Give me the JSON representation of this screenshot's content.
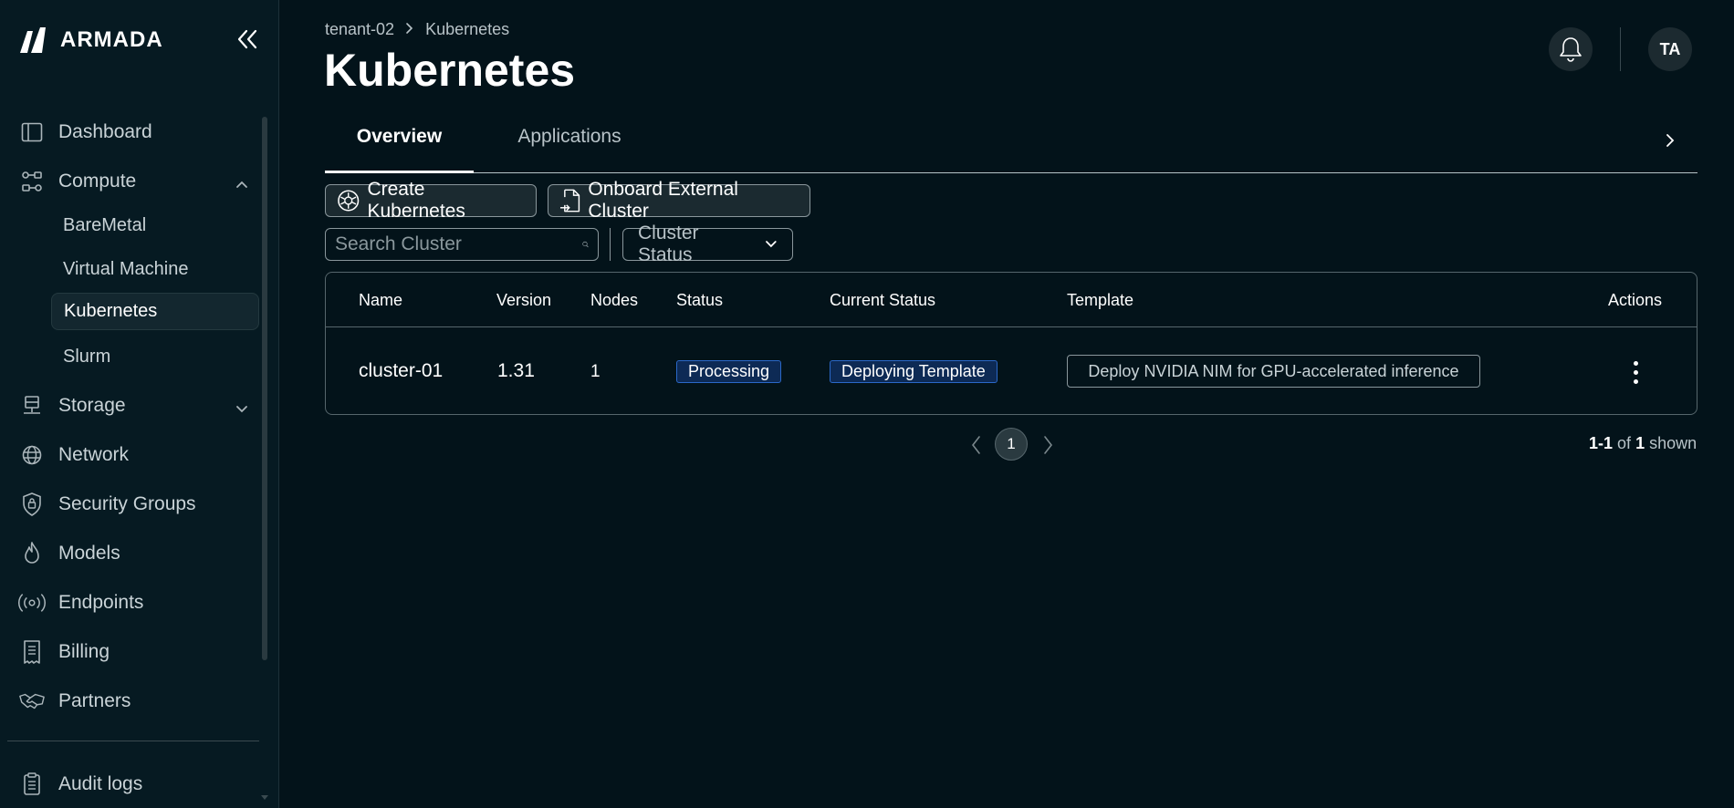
{
  "sidebar": {
    "brand": "ARMADA",
    "items": {
      "dashboard": "Dashboard",
      "compute": "Compute",
      "storage": "Storage",
      "network": "Network",
      "security_groups": "Security Groups",
      "models": "Models",
      "endpoints": "Endpoints",
      "billing": "Billing",
      "partners": "Partners",
      "audit_logs": "Audit logs"
    },
    "compute_children": {
      "baremetal": "BareMetal",
      "virtual_machine": "Virtual Machine",
      "kubernetes": "Kubernetes",
      "slurm": "Slurm"
    },
    "active_item": "Kubernetes"
  },
  "header": {
    "breadcrumb": [
      "tenant-02",
      "Kubernetes"
    ],
    "title": "Kubernetes",
    "avatar_initials": "TA"
  },
  "tabs": [
    "Overview",
    "Applications"
  ],
  "active_tab": "Overview",
  "toolbar": {
    "create_label": "Create Kubernetes",
    "onboard_label": "Onboard External Cluster",
    "search_placeholder": "Search Cluster",
    "filter_label": "Cluster Status"
  },
  "table": {
    "columns": [
      "Name",
      "Version",
      "Nodes",
      "Status",
      "Current Status",
      "Template",
      "Actions"
    ],
    "rows": [
      {
        "name": "cluster-01",
        "version": "1.31",
        "nodes": "1",
        "status": "Processing",
        "current_status": "Deploying Template",
        "template": "Deploy NVIDIA NIM for GPU-accelerated inference"
      }
    ]
  },
  "pagination": {
    "current_page": "1",
    "range": "1-1",
    "of_label": "of",
    "total": "1",
    "shown_label": "shown"
  },
  "colors": {
    "background": "#03131a",
    "sidebar": "#061a22",
    "badge_bg": "#0d2a55",
    "badge_border": "#2b68c8"
  }
}
